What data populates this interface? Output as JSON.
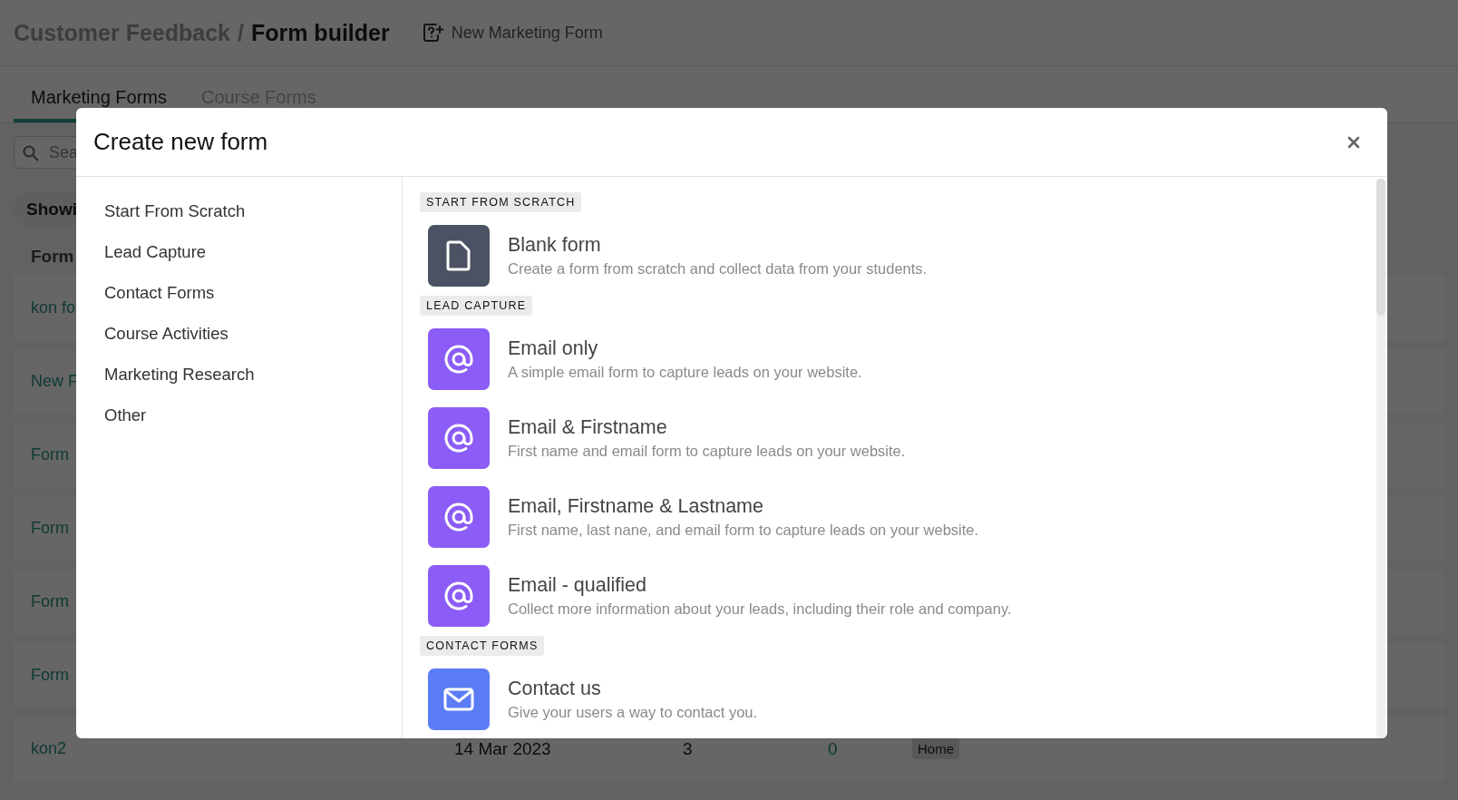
{
  "header": {
    "parent": "Customer Feedback",
    "separator": "/",
    "title": "Form builder",
    "action": "New Marketing Form"
  },
  "tabs": [
    {
      "label": "Marketing Forms",
      "selected": true
    },
    {
      "label": "Course Forms",
      "selected": false
    }
  ],
  "search": {
    "placeholder": "Sea"
  },
  "showing": "Showi",
  "table": {
    "columns": [
      "Form"
    ],
    "rows": [
      {
        "name": "kon fo"
      },
      {
        "name": "New F"
      },
      {
        "name": "Form"
      },
      {
        "name": "Form"
      },
      {
        "name": "Form"
      },
      {
        "name": "Form"
      },
      {
        "name": "kon2",
        "date": "14 Mar 2023",
        "column_3": "3",
        "column_4": "0",
        "tag": "Home"
      }
    ]
  },
  "modal": {
    "title": "Create new form",
    "categories": [
      "Start From Scratch",
      "Lead Capture",
      "Contact Forms",
      "Course Activities",
      "Marketing Research",
      "Other"
    ],
    "sections": [
      {
        "label": "START FROM SCRATCH",
        "templates": [
          {
            "kind": "blank",
            "title": "Blank form",
            "description": "Create a form from scratch and collect data from your students."
          }
        ]
      },
      {
        "label": "LEAD CAPTURE",
        "templates": [
          {
            "kind": "email",
            "title": "Email only",
            "description": "A simple email form to capture leads on your website."
          },
          {
            "kind": "email",
            "title": "Email & Firstname",
            "description": "First name and email form to capture leads on your website."
          },
          {
            "kind": "email",
            "title": "Email, Firstname & Lastname",
            "description": "First name, last nane, and email form to capture leads on your website."
          },
          {
            "kind": "email",
            "title": "Email - qualified",
            "description": "Collect more information about your leads, including their role and company."
          }
        ]
      },
      {
        "label": "CONTACT FORMS",
        "templates": [
          {
            "kind": "contact",
            "title": "Contact us",
            "description": "Give your users a way to contact you."
          }
        ]
      }
    ]
  }
}
